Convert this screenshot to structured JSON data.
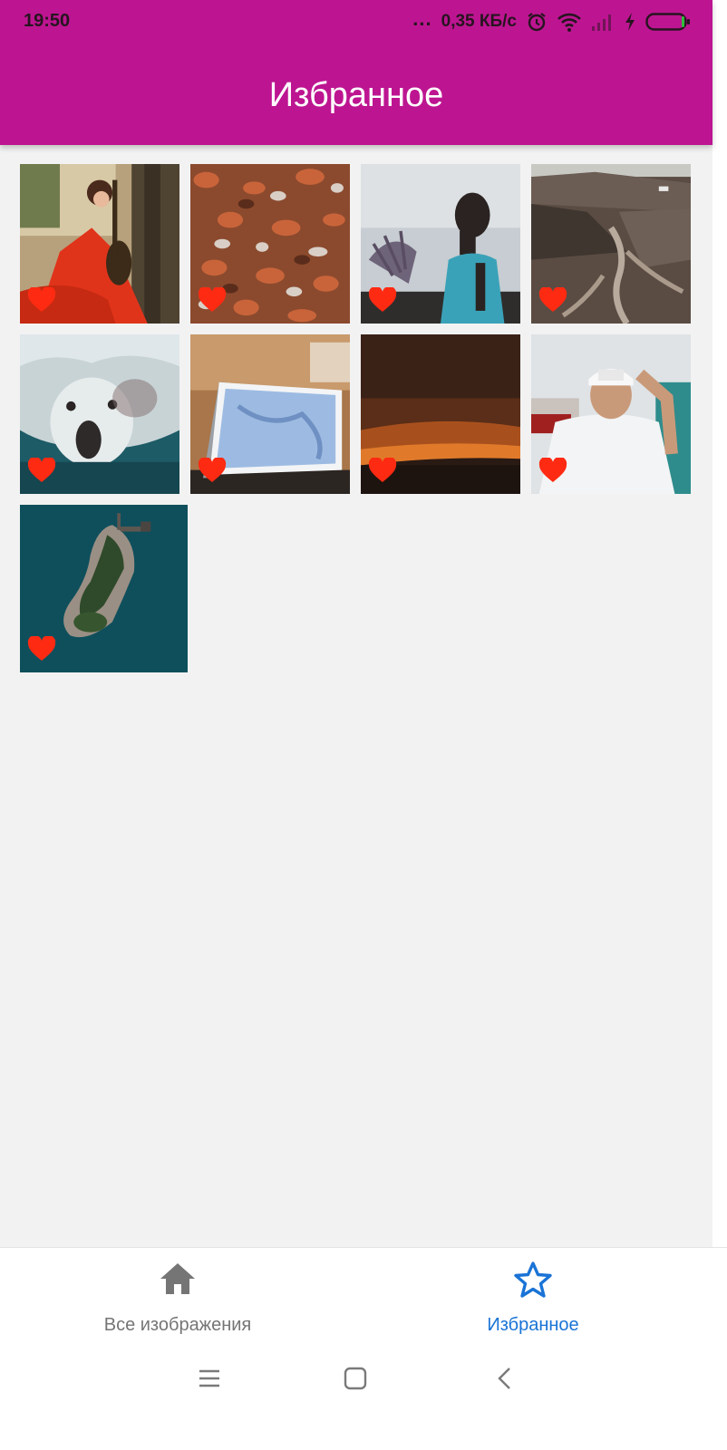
{
  "status_bar": {
    "time": "19:50",
    "dots": "...",
    "network_speed": "0,35 КБ/с",
    "icons": [
      "alarm-icon",
      "wifi-icon",
      "signal-icon",
      "charging-icon",
      "battery-icon"
    ]
  },
  "app_bar": {
    "title": "Избранное",
    "color": "#bd1591"
  },
  "favorites": {
    "heart_color": "#ff2a12",
    "images": [
      {
        "subject": "woman in red dress with instrument",
        "favorited": true
      },
      {
        "subject": "autumn leaves",
        "favorited": true
      },
      {
        "subject": "woman holding lavender",
        "favorited": true
      },
      {
        "subject": "mountain valley",
        "favorited": true
      },
      {
        "subject": "polar bear underwater",
        "favorited": true
      },
      {
        "subject": "laptop on desk",
        "favorited": true
      },
      {
        "subject": "sunset clouds",
        "favorited": true
      },
      {
        "subject": "man in cap",
        "favorited": true
      },
      {
        "subject": "aerial island",
        "favorited": true
      }
    ]
  },
  "bottom_nav": {
    "items": [
      {
        "label": "Все изображения",
        "icon": "home-icon",
        "active": false
      },
      {
        "label": "Избранное",
        "icon": "star-icon",
        "active": true
      }
    ],
    "active_color": "#1a73d6",
    "inactive_color": "#757575"
  },
  "system_nav": {
    "buttons": [
      "menu-icon",
      "home-square-icon",
      "back-icon"
    ]
  }
}
